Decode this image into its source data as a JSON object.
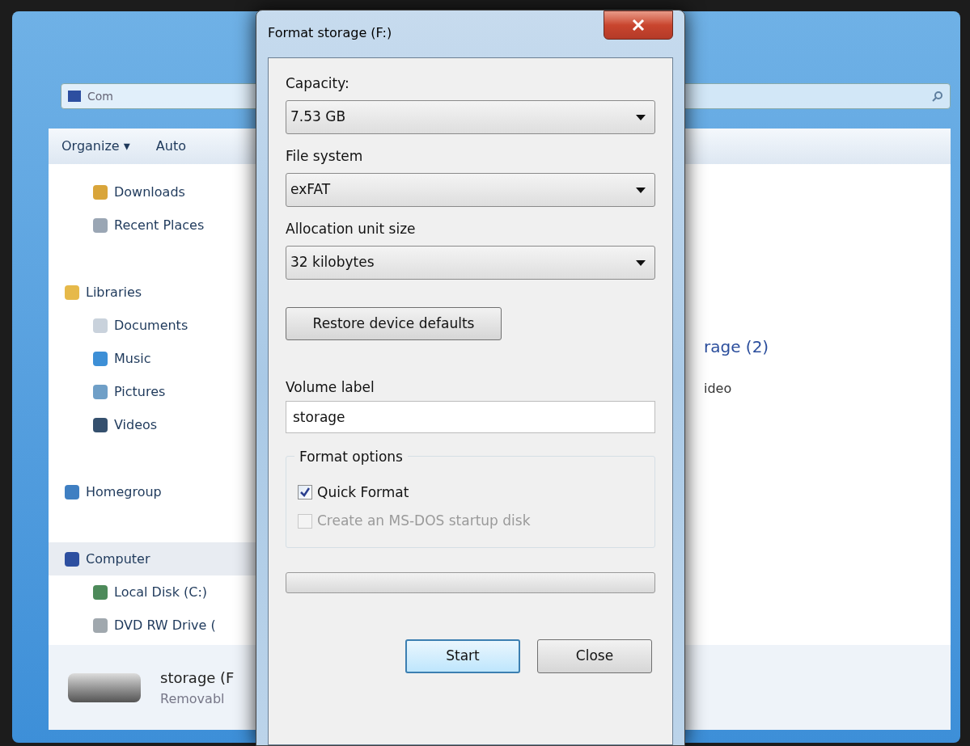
{
  "background_window": {
    "address_fragment": "Com",
    "toolbar": [
      "Organize ▾",
      "Auto"
    ],
    "sidebar": [
      {
        "label": "Downloads",
        "kind": "item",
        "color": "#d9a53a",
        "selected": false
      },
      {
        "label": "Recent Places",
        "kind": "item",
        "color": "#9aa6b4",
        "selected": false
      },
      {
        "label": "Libraries",
        "kind": "heading",
        "color": "#e6b94a",
        "selected": false
      },
      {
        "label": "Documents",
        "kind": "item",
        "color": "#c9d2dc",
        "selected": false
      },
      {
        "label": "Music",
        "kind": "item",
        "color": "#3d8fd6",
        "selected": false
      },
      {
        "label": "Pictures",
        "kind": "item",
        "color": "#6f9fc7",
        "selected": false
      },
      {
        "label": "Videos",
        "kind": "item",
        "color": "#35506e",
        "selected": false
      },
      {
        "label": "Homegroup",
        "kind": "heading",
        "color": "#3f7fc2",
        "selected": false
      },
      {
        "label": "Computer",
        "kind": "heading",
        "color": "#2d4fa0",
        "selected": true
      },
      {
        "label": "Local Disk (C:)",
        "kind": "item",
        "color": "#4d8a5a",
        "selected": false
      },
      {
        "label": "DVD RW Drive (",
        "kind": "item",
        "color": "#a0a8ae",
        "selected": false
      }
    ],
    "group_heading": "rage (2)",
    "item_fragment": "ideo",
    "details": {
      "name": "storage (F",
      "type": "Removabl"
    }
  },
  "dialog": {
    "title": "Format storage (F:)",
    "fields": [
      {
        "label": "Capacity:",
        "value": "7.53 GB"
      },
      {
        "label": "File system",
        "value": "exFAT"
      },
      {
        "label": "Allocation unit size",
        "value": "32 kilobytes"
      }
    ],
    "restore_button": "Restore device defaults",
    "volume_label": {
      "label": "Volume label",
      "value": "storage"
    },
    "format_options": {
      "legend": "Format options",
      "options": [
        {
          "label": "Quick Format",
          "checked": true,
          "disabled": false
        },
        {
          "label": "Create an MS-DOS startup disk",
          "checked": false,
          "disabled": true
        }
      ]
    },
    "progress": {
      "level": 0
    },
    "buttons": [
      {
        "label": "Start",
        "default": true
      },
      {
        "label": "Close",
        "default": false
      }
    ]
  }
}
